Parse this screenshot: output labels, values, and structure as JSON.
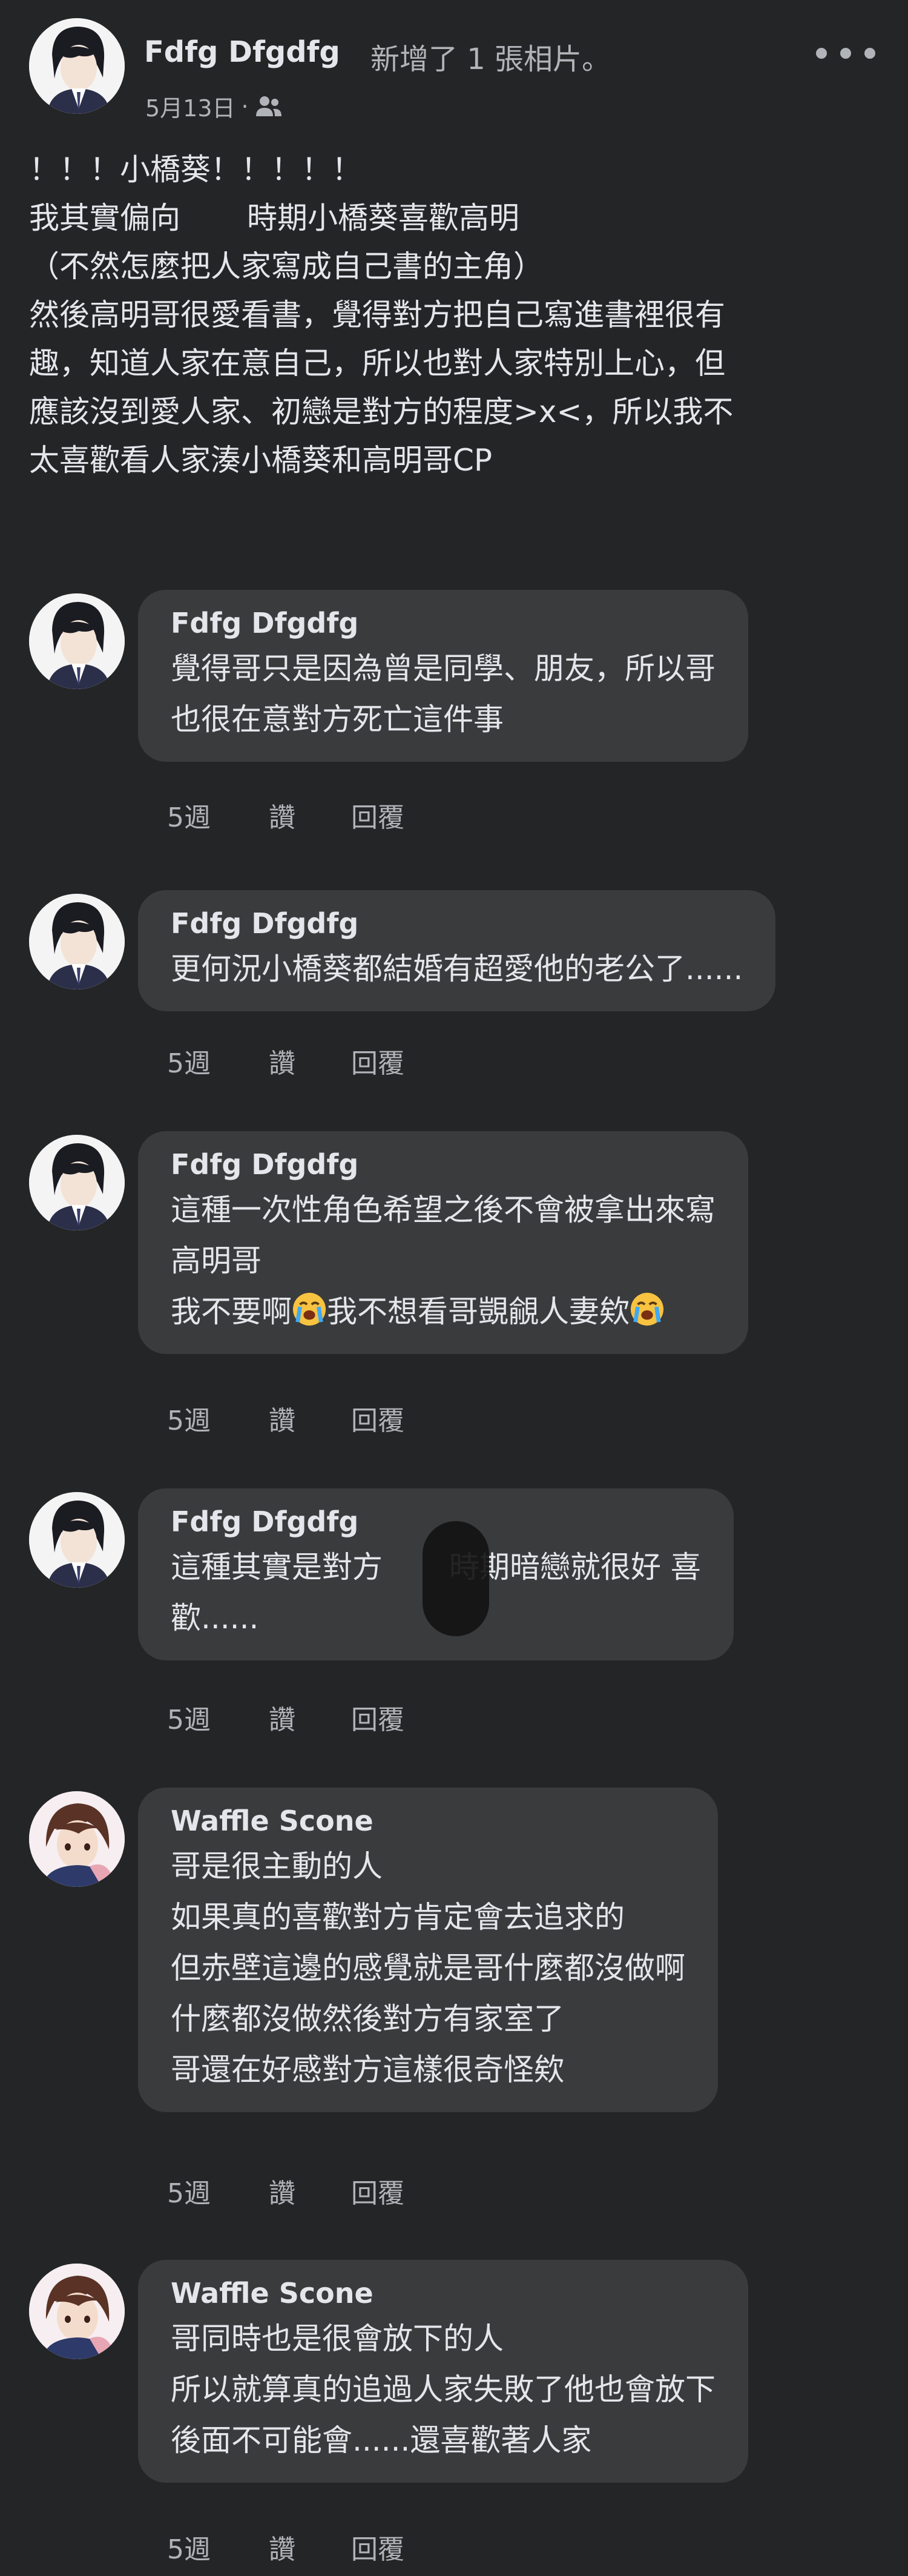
{
  "post": {
    "author": "Fdfg Dfgdfg",
    "action": "新增了 1 張相片。",
    "date": "5月13日",
    "separator": "·",
    "audience_icon": "friends-icon",
    "more_icon": "more-dots-icon",
    "body_lines": [
      "！！！小橋葵！！！！！",
      "我其實偏向",
      "時期小橋葵喜歡高明",
      "（不然怎麼把人家寫成自己書的主角）",
      "然後高明哥很愛看書，覺得對方把自己寫進書裡很有",
      "趣，知道人家在意自己，所以也對人家特別上心，但",
      "應該沒到愛人家、初戀是對方的程度>x<，所以我不",
      "太喜歡看人家湊小橋葵和高明哥CP"
    ]
  },
  "comments": [
    {
      "author": "Fdfg Dfgdfg",
      "lines": [
        "覺得哥只是因為曾是同學、朋友，所以哥",
        "也很在意對方死亡這件事"
      ],
      "time": "5週",
      "like": "讚",
      "reply": "回覆"
    },
    {
      "author": "Fdfg Dfgdfg",
      "lines": [
        "更何況小橋葵都結婚有超愛他的老公了......"
      ],
      "time": "5週",
      "like": "讚",
      "reply": "回覆"
    },
    {
      "author": "Fdfg Dfgdfg",
      "lines": [
        "這種一次性角色希望之後不會被拿出來寫",
        "高明哥",
        "我不要啊",
        "我不想看哥覬覦人妻欸"
      ],
      "time": "5週",
      "like": "讚",
      "reply": "回覆"
    },
    {
      "author": "Fdfg Dfgdfg",
      "lines": [
        "這種其實是對方",
        "時期暗戀就很好 喜",
        "歡......"
      ],
      "time": "5週",
      "like": "讚",
      "reply": "回覆"
    },
    {
      "author": "Waffle Scone",
      "lines": [
        "哥是很主動的人",
        "如果真的喜歡對方肯定會去追求的",
        "但赤壁這邊的感覺就是哥什麼都沒做啊",
        "什麼都沒做然後對方有家室了",
        "哥還在好感對方這樣很奇怪欸"
      ],
      "time": "5週",
      "like": "讚",
      "reply": "回覆"
    },
    {
      "author": "Waffle Scone",
      "lines": [
        "哥同時也是很會放下的人",
        "所以就算真的追過人家失敗了他也會放下",
        "後面不可能會......還喜歡著人家"
      ],
      "time": "5週",
      "like": "讚",
      "reply": "回覆"
    }
  ],
  "icons": {
    "crying_emoji": "loudly-crying-face-emoji"
  },
  "colors": {
    "background": "#242526",
    "bubble": "#3a3b3c",
    "primary_text": "#e4e6eb",
    "secondary_text": "#b0b3b8"
  }
}
